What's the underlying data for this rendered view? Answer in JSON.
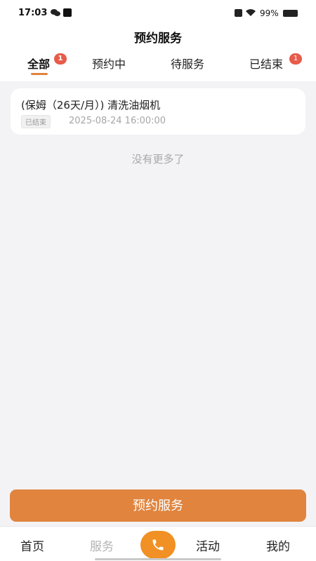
{
  "status_bar": {
    "time": "17:03",
    "battery": "99%"
  },
  "header": {
    "title": "预约服务"
  },
  "tabs": [
    {
      "label": "全部",
      "badge": "1",
      "active": true
    },
    {
      "label": "预约中"
    },
    {
      "label": "待服务"
    },
    {
      "label": "已结束",
      "badge": "1"
    }
  ],
  "orders": [
    {
      "title": "(保姆（26天/月）) 清洗油烟机",
      "status": "已结束",
      "time": "2025-08-24 16:00:00"
    }
  ],
  "list_end_text": "没有更多了",
  "primary_button": "预约服务",
  "bottom_nav": {
    "home": "首页",
    "service": "服务",
    "activity": "活动",
    "mine": "我的"
  },
  "colors": {
    "accent": "#e0843e",
    "call_button": "#f19024",
    "badge": "#e85b4a"
  },
  "icons": {
    "call": "phone-icon"
  }
}
